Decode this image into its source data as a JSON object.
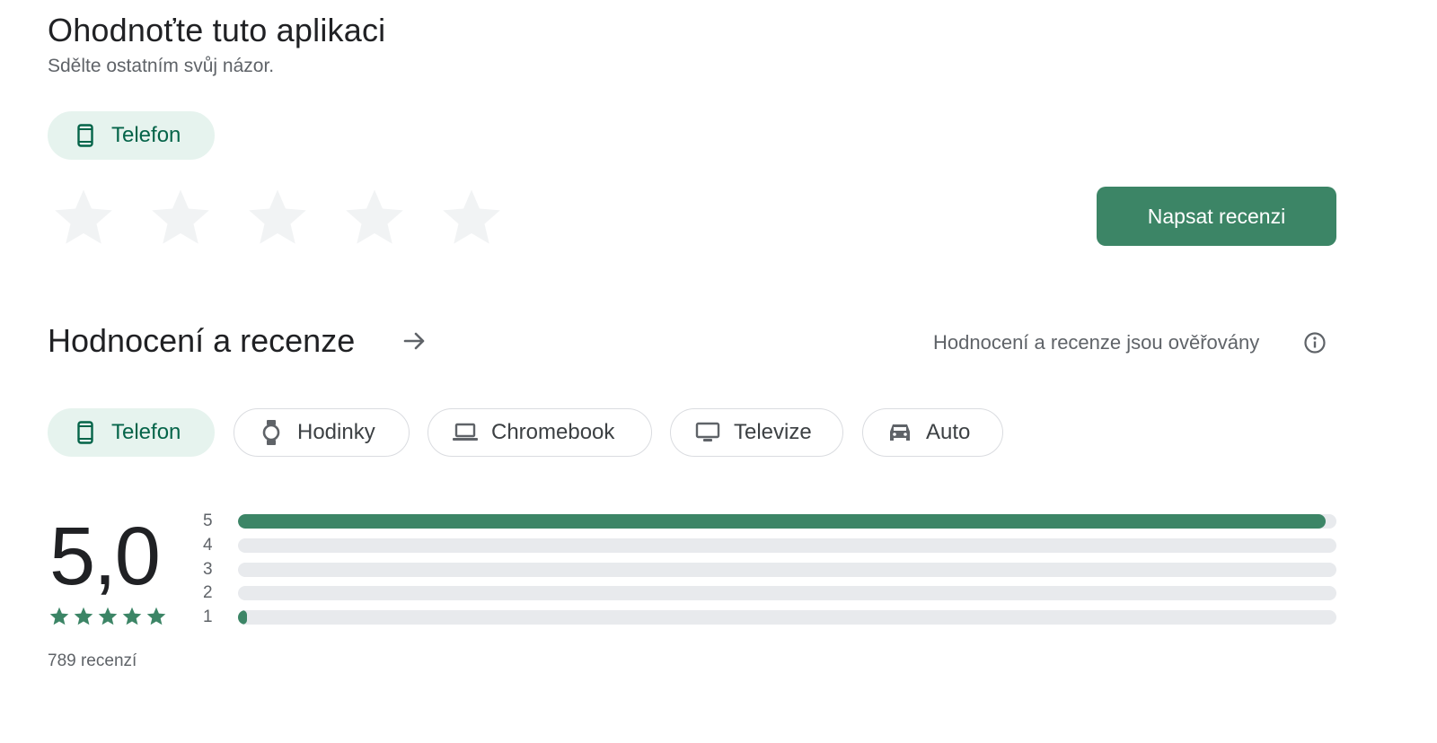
{
  "rate_app": {
    "title": "Ohodnoťte tuto aplikaci",
    "subtitle": "Sdělte ostatním svůj názor.",
    "device_chip": "Telefon",
    "write_review_label": "Napsat recenzi",
    "stars_selected": 0,
    "stars_total": 5
  },
  "ratings": {
    "title": "Hodnocení a recenze",
    "verified_text": "Hodnocení a recenze jsou ověřovány",
    "device_tabs": [
      {
        "label": "Telefon",
        "icon": "phone-icon",
        "active": true
      },
      {
        "label": "Hodinky",
        "icon": "watch-icon",
        "active": false
      },
      {
        "label": "Chromebook",
        "icon": "laptop-icon",
        "active": false
      },
      {
        "label": "Televize",
        "icon": "tv-icon",
        "active": false
      },
      {
        "label": "Auto",
        "icon": "car-icon",
        "active": false
      }
    ],
    "average": "5,0",
    "average_stars": 5,
    "review_count": "789 recenzí",
    "histogram": [
      {
        "label": "5",
        "fraction": 0.99
      },
      {
        "label": "4",
        "fraction": 0
      },
      {
        "label": "3",
        "fraction": 0
      },
      {
        "label": "2",
        "fraction": 0
      },
      {
        "label": "1",
        "fraction": 0.008
      }
    ]
  },
  "colors": {
    "accent": "#3c8566",
    "chip_active_bg": "#e6f3ee",
    "chip_active_text": "#056449",
    "star_empty": "#f1f3f4",
    "track": "#e8eaed"
  }
}
